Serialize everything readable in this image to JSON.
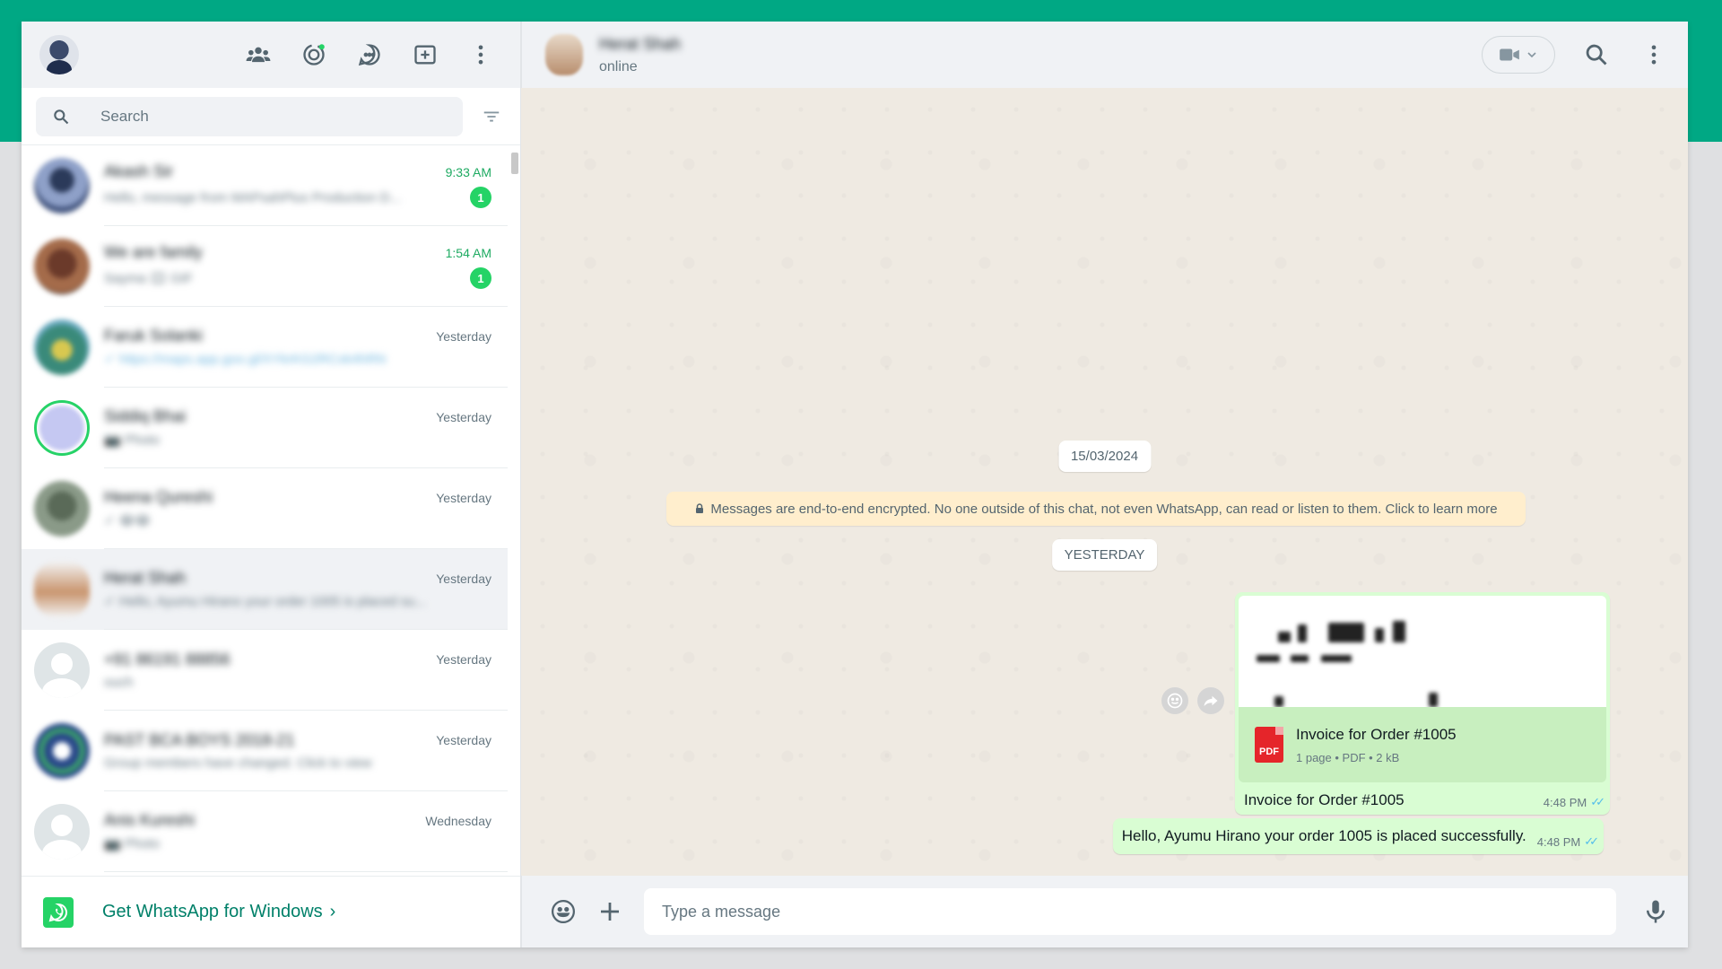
{
  "colors": {
    "brand": "#00a884",
    "accent_green": "#25d366",
    "bubble_out": "#d9fdd3",
    "bg_chat": "#efeae2"
  },
  "sidebar": {
    "icons": [
      "communities-icon",
      "status-icon",
      "channels-icon",
      "new-chat-icon",
      "menu-icon"
    ],
    "search": {
      "placeholder": "Search"
    },
    "chats": [
      {
        "name": "Akash Sir",
        "time": "9:33 AM",
        "preview": "Hello, message from MAPsahPlus Production D...",
        "unread": "1"
      },
      {
        "name": "We are family",
        "time": "1:54 AM",
        "preview": "Sayma 🎞 GIF",
        "unread": "1"
      },
      {
        "name": "Faruk Solanki",
        "time": "Yesterday",
        "preview": "✓ https://maps.app.goo.gl/XYkrKG2RCxk4hRN"
      },
      {
        "name": "Siddiq Bhai",
        "time": "Yesterday",
        "preview": "📷 Photo"
      },
      {
        "name": "Heena Qureshi",
        "time": "Yesterday",
        "preview": "✓ 😂😂"
      },
      {
        "name": "Herat Shah",
        "time": "Yesterday",
        "preview": "✓ Hello, Ayumu Hirano your order 1005 is placed su..."
      },
      {
        "name": "+91 86191 88856",
        "time": "Yesterday",
        "preview": "ouch"
      },
      {
        "name": "PAST BCA BOYS 2018-21",
        "time": "Yesterday",
        "preview": "Group members have changed. Click to view"
      },
      {
        "name": "Anis Kureshi",
        "time": "Wednesday",
        "preview": "📷 Photo"
      }
    ],
    "get_app": "Get WhatsApp for Windows",
    "get_app_chevron": "›"
  },
  "conversation": {
    "contact_name": "Herat Shah",
    "status": "online",
    "date_chip_1": "15/03/2024",
    "encryption_note": "Messages are end-to-end encrypted. No one outside of this chat, not even WhatsApp, can read or listen to them. Click to learn more",
    "date_chip_2": "YESTERDAY",
    "doc_message": {
      "title": "Invoice for Order #1005",
      "meta": "1 page • PDF • 2 kB",
      "pdf_label": "PDF",
      "caption": "Invoice for Order #1005",
      "time": "4:48 PM",
      "ticks": "✓✓"
    },
    "text_message": {
      "text": "Hello, Ayumu Hirano your order 1005 is placed successfully.",
      "time": "4:48 PM",
      "ticks": "✓✓"
    },
    "composer": {
      "placeholder": "Type a message"
    }
  }
}
